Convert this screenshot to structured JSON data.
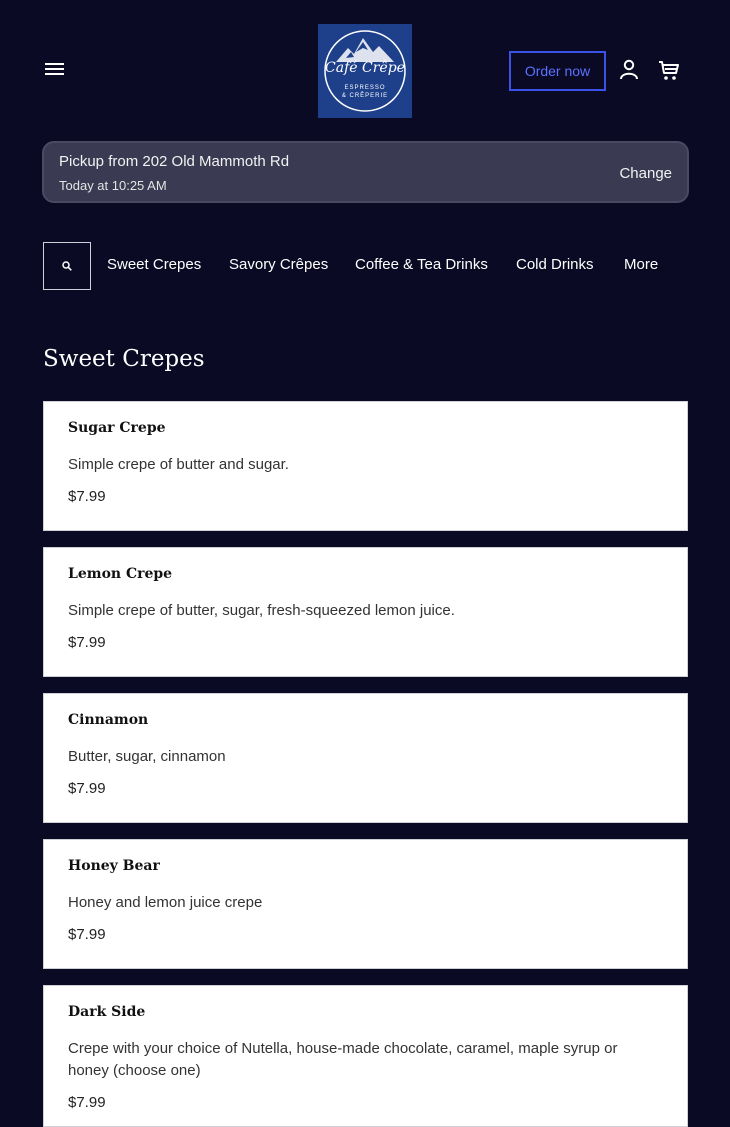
{
  "header": {
    "logo": {
      "name": "Café Crêpe",
      "tagline_1": "ESPRESSO",
      "tagline_2": "& CRÊPERIE",
      "background_color": "#1e3f8a"
    },
    "order_now_label": "Order now",
    "icons": [
      "menu-icon",
      "user-icon",
      "cart-icon"
    ]
  },
  "pickup": {
    "title": "Pickup from 202 Old Mammoth Rd",
    "time": "Today at 10:25 AM",
    "change_label": "Change"
  },
  "categories": {
    "search_icon": "search-icon",
    "items": [
      "Sweet Crepes",
      "Savory Crêpes",
      "Coffee & Tea Drinks",
      "Cold Drinks",
      "More"
    ]
  },
  "section": {
    "title": "Sweet Crepes",
    "items": [
      {
        "name": "Sugar Crepe",
        "description": "Simple crepe of butter and sugar.",
        "price": "$7.99"
      },
      {
        "name": "Lemon Crepe",
        "description": "Simple crepe of butter, sugar, fresh-squeezed lemon juice.",
        "price": "$7.99"
      },
      {
        "name": "Cinnamon",
        "description": "Butter, sugar, cinnamon",
        "price": "$7.99"
      },
      {
        "name": "Honey Bear",
        "description": "Honey and lemon juice crepe",
        "price": "$7.99"
      },
      {
        "name": "Dark Side",
        "description": "Crepe with your choice of Nutella, house-made chocolate, caramel, maple syrup or honey (choose one)",
        "price": "$7.99"
      }
    ]
  },
  "colors": {
    "background": "#0a0a24",
    "accent": "#3b52e8",
    "pickup_bar": "#3a3a52"
  }
}
